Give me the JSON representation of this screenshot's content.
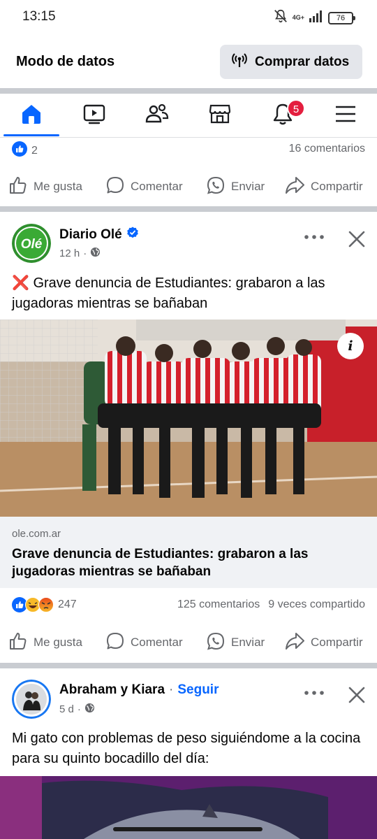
{
  "status_bar": {
    "time": "13:15",
    "network": "4G+",
    "battery": "76"
  },
  "data_mode": {
    "title": "Modo de datos",
    "buy_button": "Comprar datos"
  },
  "nav": {
    "active_tab": "home",
    "notifications_badge": "5",
    "tabs": [
      "home-icon",
      "video-icon",
      "friends-icon",
      "marketplace-icon",
      "notifications-icon",
      "menu-icon"
    ]
  },
  "prev_post": {
    "reactions_count": "2",
    "comments": "16 comentarios"
  },
  "actions": {
    "like": "Me gusta",
    "comment": "Comentar",
    "send": "Enviar",
    "share": "Compartir"
  },
  "post1": {
    "author": "Diario Olé",
    "avatar_text": "Olé",
    "verified": true,
    "time": "12 h",
    "text": "Grave denuncia de Estudiantes: grabaron a las jugadoras mientras se bañaban",
    "text_emoji": "❌",
    "link_domain": "ole.com.ar",
    "link_title": "Grave denuncia de Estudiantes: grabaron a las jugadoras mientras se bañaban",
    "info_button": "i",
    "reactions_count": "247",
    "comments": "125 comentarios",
    "shares": "9 veces compartido"
  },
  "post2": {
    "author": "Abraham y Kiara",
    "separator": "·",
    "follow": "Seguir",
    "time": "5 d",
    "text": "Mi gato con problemas de peso siguiéndome a la cocina para su quinto bocadillo del día:"
  },
  "colors": {
    "facebook_blue": "#0866ff",
    "badge_red": "#e41e3f",
    "separator": "#c9ccd1",
    "secondary_text": "#65676b",
    "ole_green": "#3aaa35"
  }
}
